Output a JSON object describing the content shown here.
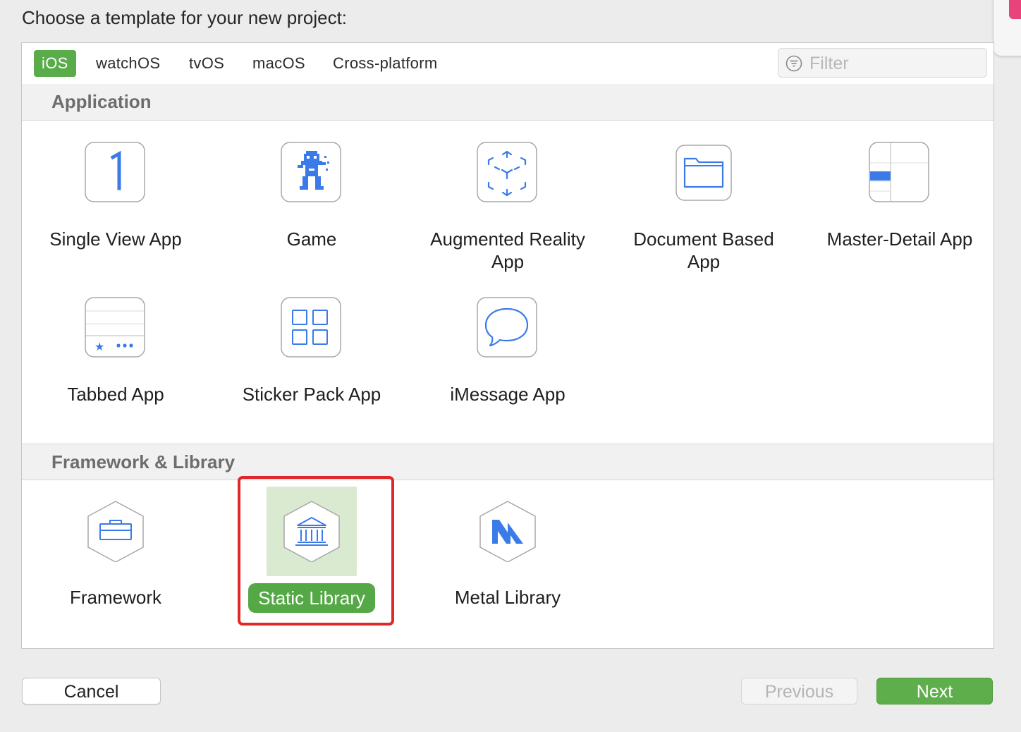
{
  "dialog": {
    "heading": "Choose a template for your new project:"
  },
  "tabs": [
    {
      "label": "iOS",
      "active": true
    },
    {
      "label": "watchOS"
    },
    {
      "label": "tvOS"
    },
    {
      "label": "macOS"
    },
    {
      "label": "Cross-platform"
    }
  ],
  "filter": {
    "placeholder": "Filter",
    "value": ""
  },
  "sections": [
    {
      "title": "Application",
      "items": [
        {
          "label": "Single View App",
          "icon": "single-view-icon"
        },
        {
          "label": "Game",
          "icon": "game-icon"
        },
        {
          "label": "Augmented Reality App",
          "icon": "ar-cube-icon"
        },
        {
          "label": "Document Based App",
          "icon": "folder-icon"
        },
        {
          "label": "Master-Detail App",
          "icon": "master-detail-icon"
        },
        {
          "label": "Tabbed App",
          "icon": "tabbed-icon"
        },
        {
          "label": "Sticker Pack App",
          "icon": "sticker-grid-icon"
        },
        {
          "label": "iMessage App",
          "icon": "speech-bubble-icon"
        }
      ]
    },
    {
      "title": "Framework & Library",
      "items": [
        {
          "label": "Framework",
          "icon": "toolbox-icon"
        },
        {
          "label": "Static Library",
          "icon": "library-building-icon",
          "selected": true
        },
        {
          "label": "Metal Library",
          "icon": "metal-icon"
        }
      ]
    }
  ],
  "buttons": {
    "cancel": "Cancel",
    "previous": "Previous",
    "next": "Next"
  },
  "colors": {
    "accent": "#5aab4a",
    "icon_blue": "#3b7be8",
    "highlight_box": "#e0282a"
  }
}
